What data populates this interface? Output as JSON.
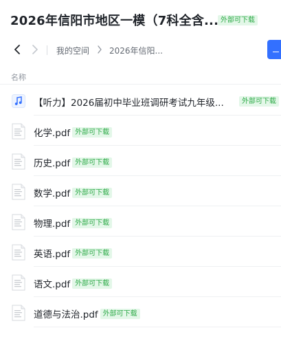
{
  "header": {
    "title": "2026年信阳市地区一模（7科全含...",
    "badge": "外部可下载"
  },
  "nav": {
    "breadcrumb": [
      "我的空间",
      "2026年信阳..."
    ]
  },
  "list": {
    "column_header": "名称",
    "files": [
      {
        "name": "【听力】2026届初中毕业班调研考试九年级...",
        "badge": "外部可下载",
        "icon": "audio-file-icon"
      },
      {
        "name": "化学.pdf",
        "badge": "外部可下载",
        "icon": "pdf-file-icon"
      },
      {
        "name": "历史.pdf",
        "badge": "外部可下载",
        "icon": "pdf-file-icon"
      },
      {
        "name": "数学.pdf",
        "badge": "外部可下载",
        "icon": "pdf-file-icon"
      },
      {
        "name": "物理.pdf",
        "badge": "外部可下载",
        "icon": "pdf-file-icon"
      },
      {
        "name": "英语.pdf",
        "badge": "外部可下载",
        "icon": "pdf-file-icon"
      },
      {
        "name": "语文.pdf",
        "badge": "外部可下载",
        "icon": "pdf-file-icon"
      },
      {
        "name": "道德与法治.pdf",
        "badge": "外部可下载",
        "icon": "pdf-file-icon"
      }
    ]
  },
  "colors": {
    "accent": "#3370ff",
    "badge_bg": "#e3f7e8",
    "badge_text": "#2eaa48"
  }
}
